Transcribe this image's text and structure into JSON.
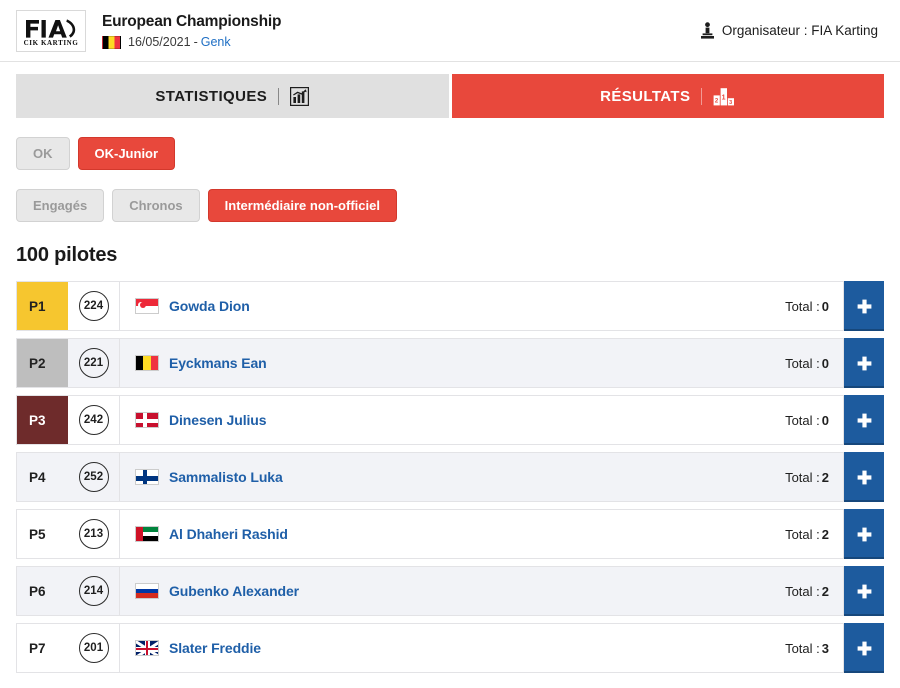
{
  "header": {
    "logo_alt": "FIA CIK Karting",
    "logo_text_top": "FiA",
    "logo_text_bottom": "CIK KARTING",
    "event_title": "European Championship",
    "country_flag": "be",
    "date": "16/05/2021",
    "separator": "-",
    "city": "Genk",
    "organiser_label": "Organisateur : FIA Karting",
    "organiser_icon": "podium-person-icon"
  },
  "tabs": [
    {
      "label": "STATISTIQUES",
      "icon": "bar-chart-icon",
      "active": false
    },
    {
      "label": "RÉSULTATS",
      "icon": "podium-icon",
      "active": true
    }
  ],
  "category_buttons": [
    {
      "label": "OK",
      "active": false
    },
    {
      "label": "OK-Junior",
      "active": true
    }
  ],
  "session_buttons": [
    {
      "label": "Engagés",
      "active": false
    },
    {
      "label": "Chronos",
      "active": false
    },
    {
      "label": "Intermédiaire non-officiel",
      "active": true
    }
  ],
  "pilot_count": "100 pilotes",
  "results": {
    "total_prefix": "Total :",
    "add_icon": "plus-icon",
    "rows": [
      {
        "position": "P1",
        "number": "224",
        "flag": "sg",
        "name": "Gowda Dion",
        "total": "0",
        "medal": "gold"
      },
      {
        "position": "P2",
        "number": "221",
        "flag": "be",
        "name": "Eyckmans Ean",
        "total": "0",
        "medal": "silver"
      },
      {
        "position": "P3",
        "number": "242",
        "flag": "dk",
        "name": "Dinesen Julius",
        "total": "0",
        "medal": "bronze"
      },
      {
        "position": "P4",
        "number": "252",
        "flag": "fi",
        "name": "Sammalisto Luka",
        "total": "2",
        "medal": ""
      },
      {
        "position": "P5",
        "number": "213",
        "flag": "ae",
        "name": "Al Dhaheri Rashid",
        "total": "2",
        "medal": ""
      },
      {
        "position": "P6",
        "number": "214",
        "flag": "ru",
        "name": "Gubenko Alexander",
        "total": "2",
        "medal": ""
      },
      {
        "position": "P7",
        "number": "201",
        "flag": "gb",
        "name": "Slater Freddie",
        "total": "3",
        "medal": ""
      }
    ]
  },
  "colors": {
    "accent_red": "#e8483c",
    "link_blue": "#1f5fa8",
    "plus_blue": "#1D5B9E",
    "gold": "#F6C62F",
    "silver": "#BEBEBE",
    "bronze": "#6E2B2B"
  }
}
